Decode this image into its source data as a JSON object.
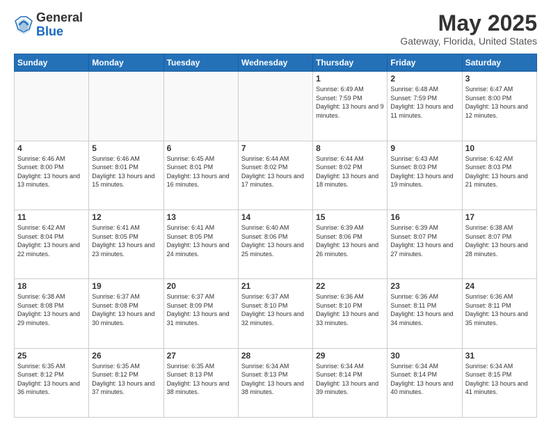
{
  "logo": {
    "general": "General",
    "blue": "Blue"
  },
  "header": {
    "title": "May 2025",
    "subtitle": "Gateway, Florida, United States"
  },
  "days_of_week": [
    "Sunday",
    "Monday",
    "Tuesday",
    "Wednesday",
    "Thursday",
    "Friday",
    "Saturday"
  ],
  "weeks": [
    [
      {
        "day": "",
        "info": ""
      },
      {
        "day": "",
        "info": ""
      },
      {
        "day": "",
        "info": ""
      },
      {
        "day": "",
        "info": ""
      },
      {
        "day": "1",
        "info": "Sunrise: 6:49 AM\nSunset: 7:59 PM\nDaylight: 13 hours and 9 minutes."
      },
      {
        "day": "2",
        "info": "Sunrise: 6:48 AM\nSunset: 7:59 PM\nDaylight: 13 hours and 11 minutes."
      },
      {
        "day": "3",
        "info": "Sunrise: 6:47 AM\nSunset: 8:00 PM\nDaylight: 13 hours and 12 minutes."
      }
    ],
    [
      {
        "day": "4",
        "info": "Sunrise: 6:46 AM\nSunset: 8:00 PM\nDaylight: 13 hours and 13 minutes."
      },
      {
        "day": "5",
        "info": "Sunrise: 6:46 AM\nSunset: 8:01 PM\nDaylight: 13 hours and 15 minutes."
      },
      {
        "day": "6",
        "info": "Sunrise: 6:45 AM\nSunset: 8:01 PM\nDaylight: 13 hours and 16 minutes."
      },
      {
        "day": "7",
        "info": "Sunrise: 6:44 AM\nSunset: 8:02 PM\nDaylight: 13 hours and 17 minutes."
      },
      {
        "day": "8",
        "info": "Sunrise: 6:44 AM\nSunset: 8:02 PM\nDaylight: 13 hours and 18 minutes."
      },
      {
        "day": "9",
        "info": "Sunrise: 6:43 AM\nSunset: 8:03 PM\nDaylight: 13 hours and 19 minutes."
      },
      {
        "day": "10",
        "info": "Sunrise: 6:42 AM\nSunset: 8:03 PM\nDaylight: 13 hours and 21 minutes."
      }
    ],
    [
      {
        "day": "11",
        "info": "Sunrise: 6:42 AM\nSunset: 8:04 PM\nDaylight: 13 hours and 22 minutes."
      },
      {
        "day": "12",
        "info": "Sunrise: 6:41 AM\nSunset: 8:05 PM\nDaylight: 13 hours and 23 minutes."
      },
      {
        "day": "13",
        "info": "Sunrise: 6:41 AM\nSunset: 8:05 PM\nDaylight: 13 hours and 24 minutes."
      },
      {
        "day": "14",
        "info": "Sunrise: 6:40 AM\nSunset: 8:06 PM\nDaylight: 13 hours and 25 minutes."
      },
      {
        "day": "15",
        "info": "Sunrise: 6:39 AM\nSunset: 8:06 PM\nDaylight: 13 hours and 26 minutes."
      },
      {
        "day": "16",
        "info": "Sunrise: 6:39 AM\nSunset: 8:07 PM\nDaylight: 13 hours and 27 minutes."
      },
      {
        "day": "17",
        "info": "Sunrise: 6:38 AM\nSunset: 8:07 PM\nDaylight: 13 hours and 28 minutes."
      }
    ],
    [
      {
        "day": "18",
        "info": "Sunrise: 6:38 AM\nSunset: 8:08 PM\nDaylight: 13 hours and 29 minutes."
      },
      {
        "day": "19",
        "info": "Sunrise: 6:37 AM\nSunset: 8:08 PM\nDaylight: 13 hours and 30 minutes."
      },
      {
        "day": "20",
        "info": "Sunrise: 6:37 AM\nSunset: 8:09 PM\nDaylight: 13 hours and 31 minutes."
      },
      {
        "day": "21",
        "info": "Sunrise: 6:37 AM\nSunset: 8:10 PM\nDaylight: 13 hours and 32 minutes."
      },
      {
        "day": "22",
        "info": "Sunrise: 6:36 AM\nSunset: 8:10 PM\nDaylight: 13 hours and 33 minutes."
      },
      {
        "day": "23",
        "info": "Sunrise: 6:36 AM\nSunset: 8:11 PM\nDaylight: 13 hours and 34 minutes."
      },
      {
        "day": "24",
        "info": "Sunrise: 6:36 AM\nSunset: 8:11 PM\nDaylight: 13 hours and 35 minutes."
      }
    ],
    [
      {
        "day": "25",
        "info": "Sunrise: 6:35 AM\nSunset: 8:12 PM\nDaylight: 13 hours and 36 minutes."
      },
      {
        "day": "26",
        "info": "Sunrise: 6:35 AM\nSunset: 8:12 PM\nDaylight: 13 hours and 37 minutes."
      },
      {
        "day": "27",
        "info": "Sunrise: 6:35 AM\nSunset: 8:13 PM\nDaylight: 13 hours and 38 minutes."
      },
      {
        "day": "28",
        "info": "Sunrise: 6:34 AM\nSunset: 8:13 PM\nDaylight: 13 hours and 38 minutes."
      },
      {
        "day": "29",
        "info": "Sunrise: 6:34 AM\nSunset: 8:14 PM\nDaylight: 13 hours and 39 minutes."
      },
      {
        "day": "30",
        "info": "Sunrise: 6:34 AM\nSunset: 8:14 PM\nDaylight: 13 hours and 40 minutes."
      },
      {
        "day": "31",
        "info": "Sunrise: 6:34 AM\nSunset: 8:15 PM\nDaylight: 13 hours and 41 minutes."
      }
    ]
  ]
}
